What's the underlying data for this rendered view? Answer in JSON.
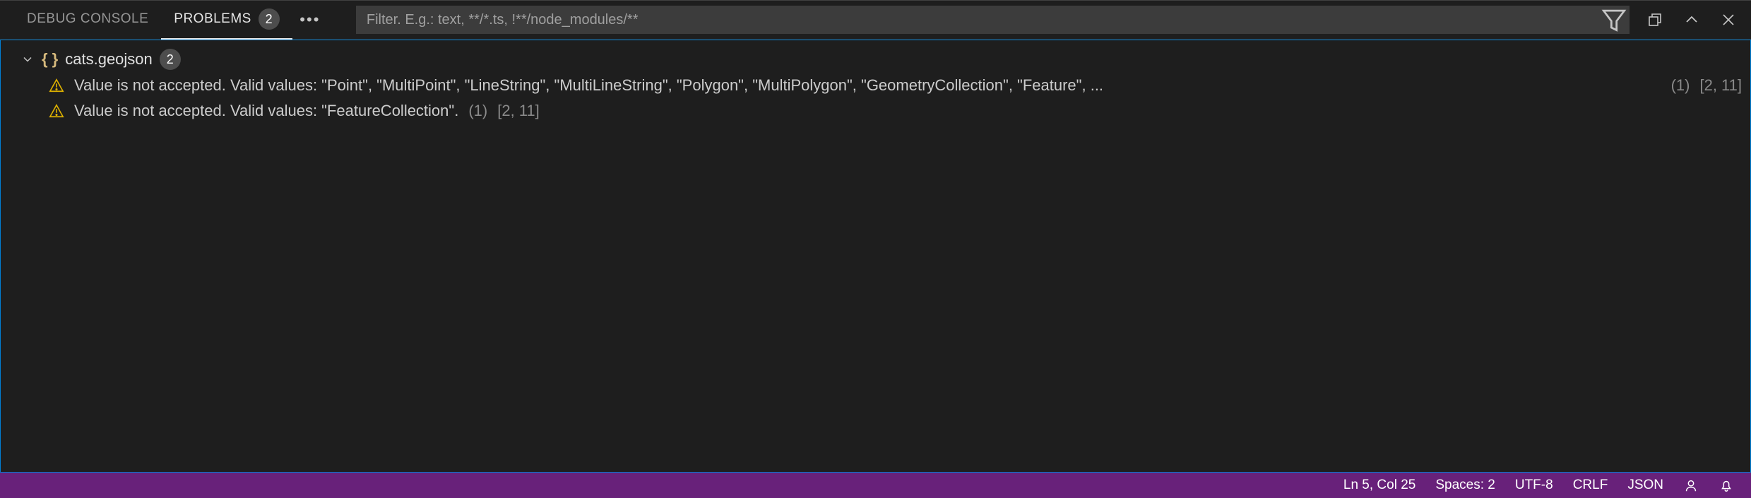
{
  "tabs": {
    "debug_console": "DEBUG CONSOLE",
    "problems": "PROBLEMS",
    "problems_badge": "2"
  },
  "filter": {
    "placeholder": "Filter. E.g.: text, **/*.ts, !**/node_modules/**",
    "value": ""
  },
  "file": {
    "name": "cats.geojson",
    "badge": "2"
  },
  "problems": [
    {
      "message": "Value is not accepted. Valid values: \"Point\", \"MultiPoint\", \"LineString\", \"MultiLineString\", \"Polygon\", \"MultiPolygon\", \"GeometryCollection\", \"Feature\", ...",
      "count": "(1)",
      "location": "[2, 11]"
    },
    {
      "message": "Value is not accepted. Valid values: \"FeatureCollection\".",
      "count": "(1)",
      "location": "[2, 11]"
    }
  ],
  "statusbar": {
    "ln_col": "Ln 5, Col 25",
    "spaces": "Spaces: 2",
    "encoding": "UTF-8",
    "eol": "CRLF",
    "lang": "JSON"
  },
  "colors": {
    "accent": "#68217a",
    "focus_border": "#007fd4",
    "brace": "#d7ba7d"
  }
}
